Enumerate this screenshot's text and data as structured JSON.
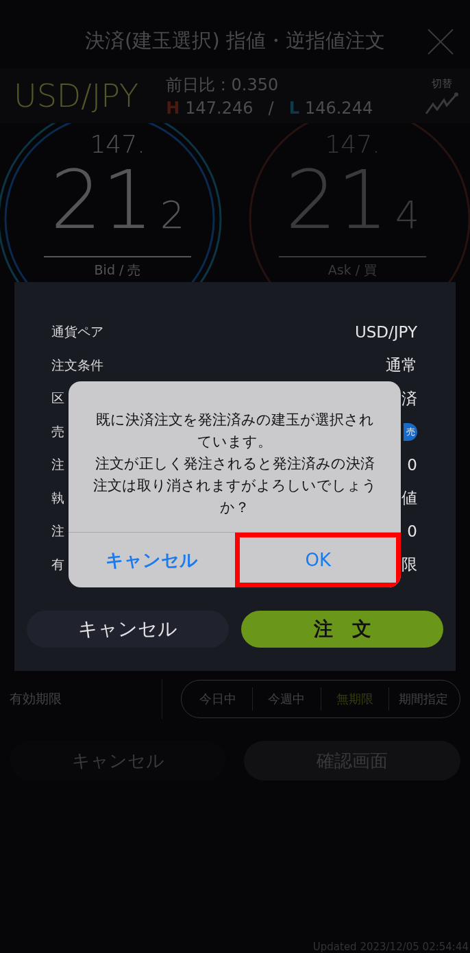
{
  "header": {
    "title": "決済(建玉選択) 指値・逆指値注文"
  },
  "quote": {
    "pair": "USD/JPY",
    "change": "前日比 : 0.350",
    "high_mark": "H",
    "high": "147.246",
    "separator": "/",
    "low_mark": "L",
    "low": "146.244",
    "switch_label": "切替"
  },
  "prices": [
    {
      "kind": "bid",
      "big_figure": "147.",
      "pips": "21",
      "fraction": "2",
      "label": "Bid / 売"
    },
    {
      "kind": "ask",
      "big_figure": "147.",
      "pips": "21",
      "fraction": "4",
      "label": "Ask / 買"
    }
  ],
  "expiry": {
    "label": "有効期限",
    "options": [
      {
        "label": "今日中",
        "selected": false
      },
      {
        "label": "今週中",
        "selected": false
      },
      {
        "label": "無期限",
        "selected": true
      },
      {
        "label": "期間指定",
        "selected": false
      }
    ]
  },
  "buttons": [
    {
      "label": "キャンセル",
      "kind": "cancel"
    },
    {
      "label": "確認画面",
      "kind": "confirm"
    }
  ],
  "footer": "Updated  2023/12/05 02:54:44",
  "confirm_panel": {
    "rows": [
      {
        "label": "通貨ペア",
        "value": "USD/JPY",
        "kind": "text"
      },
      {
        "label": "注文条件",
        "value": "通常",
        "kind": "text"
      },
      {
        "label": "区",
        "value": "済",
        "kind": "text"
      },
      {
        "label": "売",
        "value": "売",
        "kind": "badge"
      },
      {
        "label": "注",
        "value": "0",
        "kind": "text"
      },
      {
        "label": "執",
        "value": "値",
        "kind": "text"
      },
      {
        "label": "注",
        "value": "0",
        "kind": "text"
      },
      {
        "label": "有",
        "value": "限",
        "kind": "text"
      }
    ],
    "buttons": [
      {
        "label": "キャンセル",
        "kind": "cancel"
      },
      {
        "label": "注　文",
        "kind": "primary"
      }
    ]
  },
  "alert": {
    "messages": [
      "既に決済注文を発注済みの建玉が選択されています。",
      "注文が正しく発注されると発注済みの決済注文は取り消されますがよろしいでしょうか？"
    ],
    "actions": [
      {
        "label": "キャンセル",
        "kind": "cancel",
        "highlighted": false
      },
      {
        "label": "OK",
        "kind": "default",
        "highlighted": true
      }
    ]
  }
}
